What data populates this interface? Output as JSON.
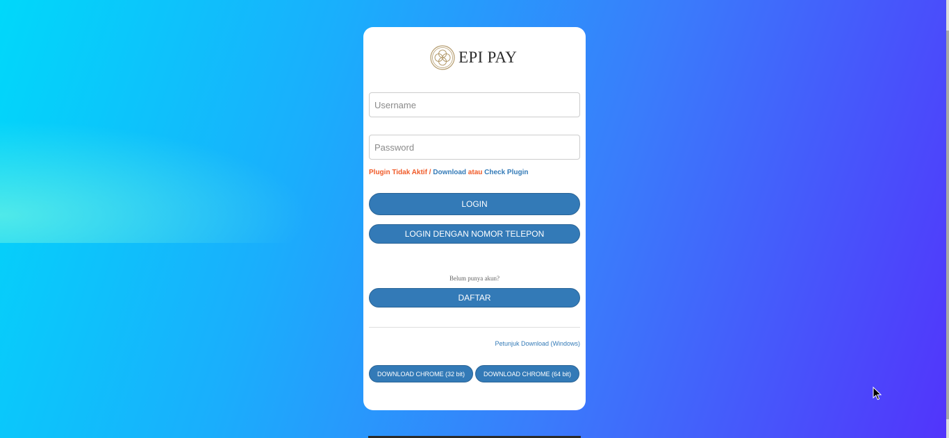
{
  "brand": {
    "name": "EPI PAY",
    "logo_icon": "epi-pay-logo-icon"
  },
  "form": {
    "username_placeholder": "Username",
    "password_placeholder": "Password",
    "username_value": "",
    "password_value": ""
  },
  "plugin": {
    "status_text": "Plugin Tidak Aktif /",
    "download_label": "Download",
    "or_text": "atau",
    "check_label": "Check Plugin"
  },
  "buttons": {
    "login": "LOGIN",
    "login_phone": "LOGIN DENGAN NOMOR TELEPON",
    "register": "DAFTAR"
  },
  "register_hint": "Belum punya akun?",
  "download": {
    "guide_label": "Petunjuk Download (Windows)",
    "chrome32_label": "DOWNLOAD CHROME (32 bit)",
    "chrome64_label": "DOWNLOAD CHROME (64 bit)"
  },
  "colors": {
    "primary": "#337ab7",
    "warning": "#f05a28",
    "logo_gold": "#b39a6b"
  }
}
